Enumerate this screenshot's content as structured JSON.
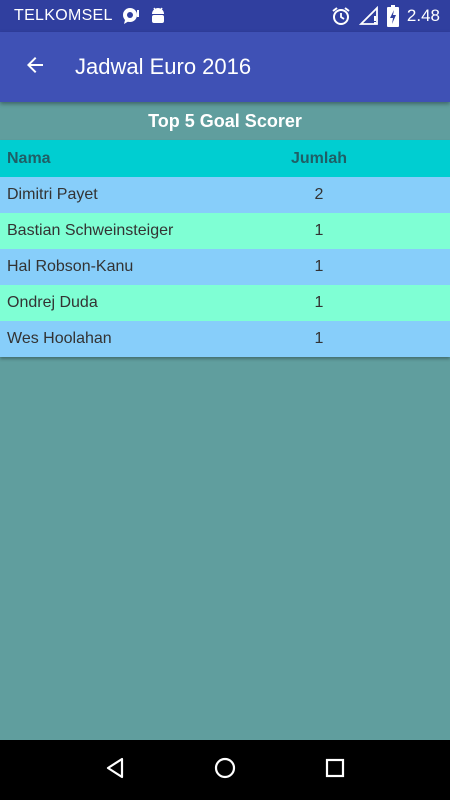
{
  "status_bar": {
    "carrier": "TELKOMSEL",
    "time": "2.48",
    "icons": [
      "chat-bubble-icon",
      "android-debug-icon",
      "alarm-icon",
      "signal-icon",
      "battery-icon"
    ]
  },
  "app_bar": {
    "title": "Jadwal Euro 2016",
    "back_icon": "arrow-left-icon"
  },
  "section": {
    "title": "Top 5 Goal Scorer"
  },
  "table": {
    "headers": {
      "name": "Nama",
      "count": "Jumlah"
    },
    "rows": [
      {
        "name": "Dimitri Payet",
        "count": "2"
      },
      {
        "name": "Bastian Schweinsteiger",
        "count": "1"
      },
      {
        "name": "Hal Robson-Kanu",
        "count": "1"
      },
      {
        "name": "Ondrej Duda",
        "count": "1"
      },
      {
        "name": "Wes Hoolahan",
        "count": "1"
      }
    ]
  },
  "nav_bar": {
    "icons": [
      "back-triangle-icon",
      "home-circle-icon",
      "recents-square-icon"
    ]
  },
  "colors": {
    "status_bar": "#303f9f",
    "app_bar": "#3f51b5",
    "background": "#609e9e",
    "table_header": "#00ced1",
    "row_odd": "#87cefa",
    "row_even": "#7fffd4"
  }
}
